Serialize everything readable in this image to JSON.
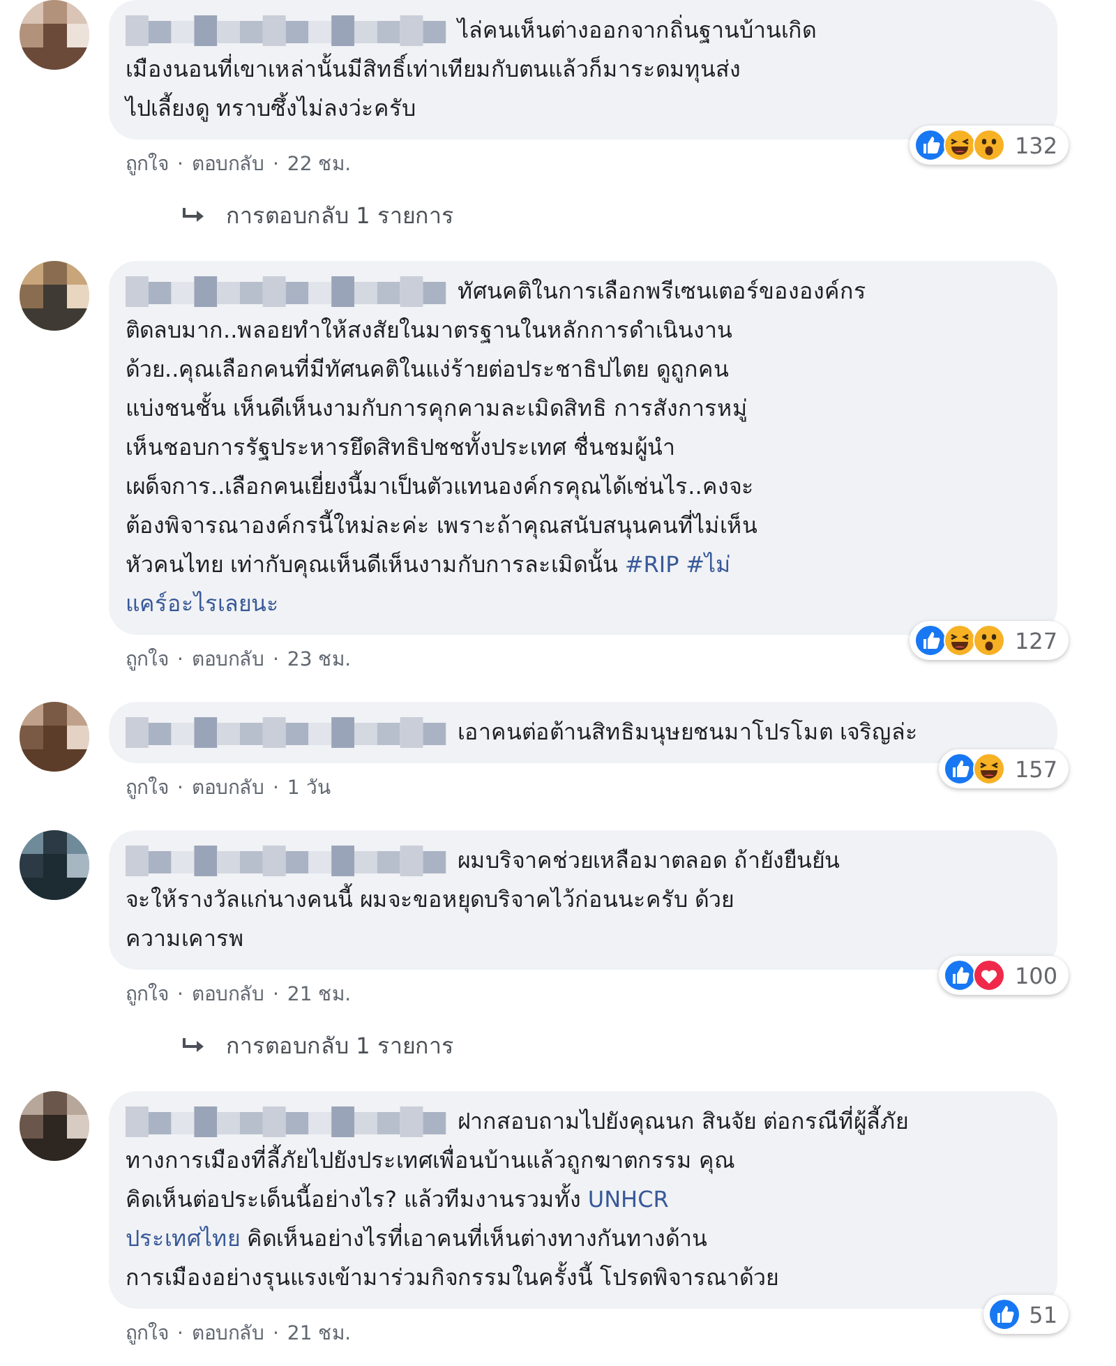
{
  "comments": [
    {
      "lines": [
        [
          {
            "kind": "text",
            "text": "ไล่คนเห็นต่างออกจากถิ่นฐานบ้านเกิด"
          }
        ],
        [
          {
            "kind": "text",
            "text": "เมืองนอนที่เขาเหล่านั้นมีสิทธิ์เท่าเทียมกับตนแล้วก็มาระดมทุนส่ง"
          }
        ],
        [
          {
            "kind": "text",
            "text": "ไปเลี้ยงดู ทราบซึ้งไม่ลงว่ะครับ"
          }
        ]
      ],
      "reactions": [
        {
          "kind": "like"
        },
        {
          "kind": "haha"
        },
        {
          "kind": "wow"
        }
      ],
      "reaction_count": "132",
      "like": "ถูกใจ",
      "separator": "·",
      "reply": "ตอบกลับ",
      "time": "22 ชม.",
      "replies_link": "การตอบกลับ 1 รายการ"
    },
    {
      "lines": [
        [
          {
            "kind": "text",
            "text": "ทัศนคติในการเลือกพรีเซนเตอร์ขององค์กร"
          }
        ],
        [
          {
            "kind": "text",
            "text": "ติดลบมาก..พลอยทำให้สงสัยในมาตรฐานในหลักการดำเนินงาน"
          }
        ],
        [
          {
            "kind": "text",
            "text": "ด้วย..คุณเลือกคนที่มีทัศนคติในแง่ร้ายต่อประชาธิปไตย ดูถูกคน"
          }
        ],
        [
          {
            "kind": "text",
            "text": "แบ่งชนชั้น เห็นดีเห็นงามกับการคุกคามละเมิดสิทธิ การสังการหมู่"
          }
        ],
        [
          {
            "kind": "text",
            "text": "เห็นชอบการรัฐประหารยึดสิทธิปชชทั้งประเทศ ชื่นชมผู้นำ"
          }
        ],
        [
          {
            "kind": "text",
            "text": "เผด็จการ..เลือกคนเยี่ยงนี้มาเป็นตัวแทนองค์กรคุณได้เช่นไร..คงจะ"
          }
        ],
        [
          {
            "kind": "text",
            "text": "ต้องพิจารณาองค์กรนี้ใหม่ละค่ะ เพราะถ้าคุณสนับสนุนคนที่ไม่เห็น"
          }
        ],
        [
          {
            "kind": "text",
            "text": "หัวคนไทย เท่ากับคุณเห็นดีเห็นงามกับการละเมิดนั้น"
          },
          {
            "kind": "link",
            "text": "#RIP"
          },
          {
            "kind": "link",
            "text": "#ไม่"
          }
        ],
        [
          {
            "kind": "link",
            "text": "แคร์อะไรเลยนะ"
          }
        ]
      ],
      "reactions": [
        {
          "kind": "like"
        },
        {
          "kind": "haha"
        },
        {
          "kind": "wow"
        }
      ],
      "reaction_count": "127",
      "like": "ถูกใจ",
      "separator": "·",
      "reply": "ตอบกลับ",
      "time": "23 ชม."
    },
    {
      "lines": [
        [
          {
            "kind": "text",
            "text": "เอาคนต่อต้านสิทธิมนุษยชนมาโปรโมต เจริญล่ะ"
          }
        ]
      ],
      "reactions": [
        {
          "kind": "like"
        },
        {
          "kind": "haha"
        }
      ],
      "reaction_count": "157",
      "like": "ถูกใจ",
      "separator": "·",
      "reply": "ตอบกลับ",
      "time": "1 วัน"
    },
    {
      "lines": [
        [
          {
            "kind": "text",
            "text": "ผมบริจาคช่วยเหลือมาตลอด ถ้ายังยืนยัน"
          }
        ],
        [
          {
            "kind": "text",
            "text": "จะให้รางวัลแก่นางคนนี้ ผมจะขอหยุดบริจาคไว้ก่อนนะครับ ด้วย"
          }
        ],
        [
          {
            "kind": "text",
            "text": "ความเคารพ"
          }
        ]
      ],
      "reactions": [
        {
          "kind": "like"
        },
        {
          "kind": "love"
        }
      ],
      "reaction_count": "100",
      "like": "ถูกใจ",
      "separator": "·",
      "reply": "ตอบกลับ",
      "time": "21 ชม.",
      "replies_link": "การตอบกลับ 1 รายการ"
    },
    {
      "lines": [
        [
          {
            "kind": "text",
            "text": "ฝากสอบถามไปยังคุณนก สินจัย ต่อกรณีที่ผู้ลี้ภัย"
          }
        ],
        [
          {
            "kind": "text",
            "text": "ทางการเมืองที่ลี้ภัยไปยังประเทศเพื่อนบ้านแล้วถูกฆาตกรรม คุณ"
          }
        ],
        [
          {
            "kind": "text",
            "text": "คิดเห็นต่อประเด็นนี้อย่างไร? แล้วทีมงานรวมทั้ง"
          },
          {
            "kind": "link",
            "text": "UNHCR"
          }
        ],
        [
          {
            "kind": "link",
            "text": "ประเทศไทย"
          },
          {
            "kind": "text",
            "text": "คิดเห็นอย่างไรที่เอาคนที่เห็นต่างทางกันทางด้าน"
          }
        ],
        [
          {
            "kind": "text",
            "text": "การเมืองอย่างรุนแรงเข้ามาร่วมกิจกรรมในครั้งนี้ โปรดพิจารณาด้วย"
          }
        ]
      ],
      "reactions": [
        {
          "kind": "like"
        }
      ],
      "reaction_count": "51",
      "like": "ถูกใจ",
      "separator": "·",
      "reply": "ตอบกลับ",
      "time": "21 ชม."
    }
  ]
}
